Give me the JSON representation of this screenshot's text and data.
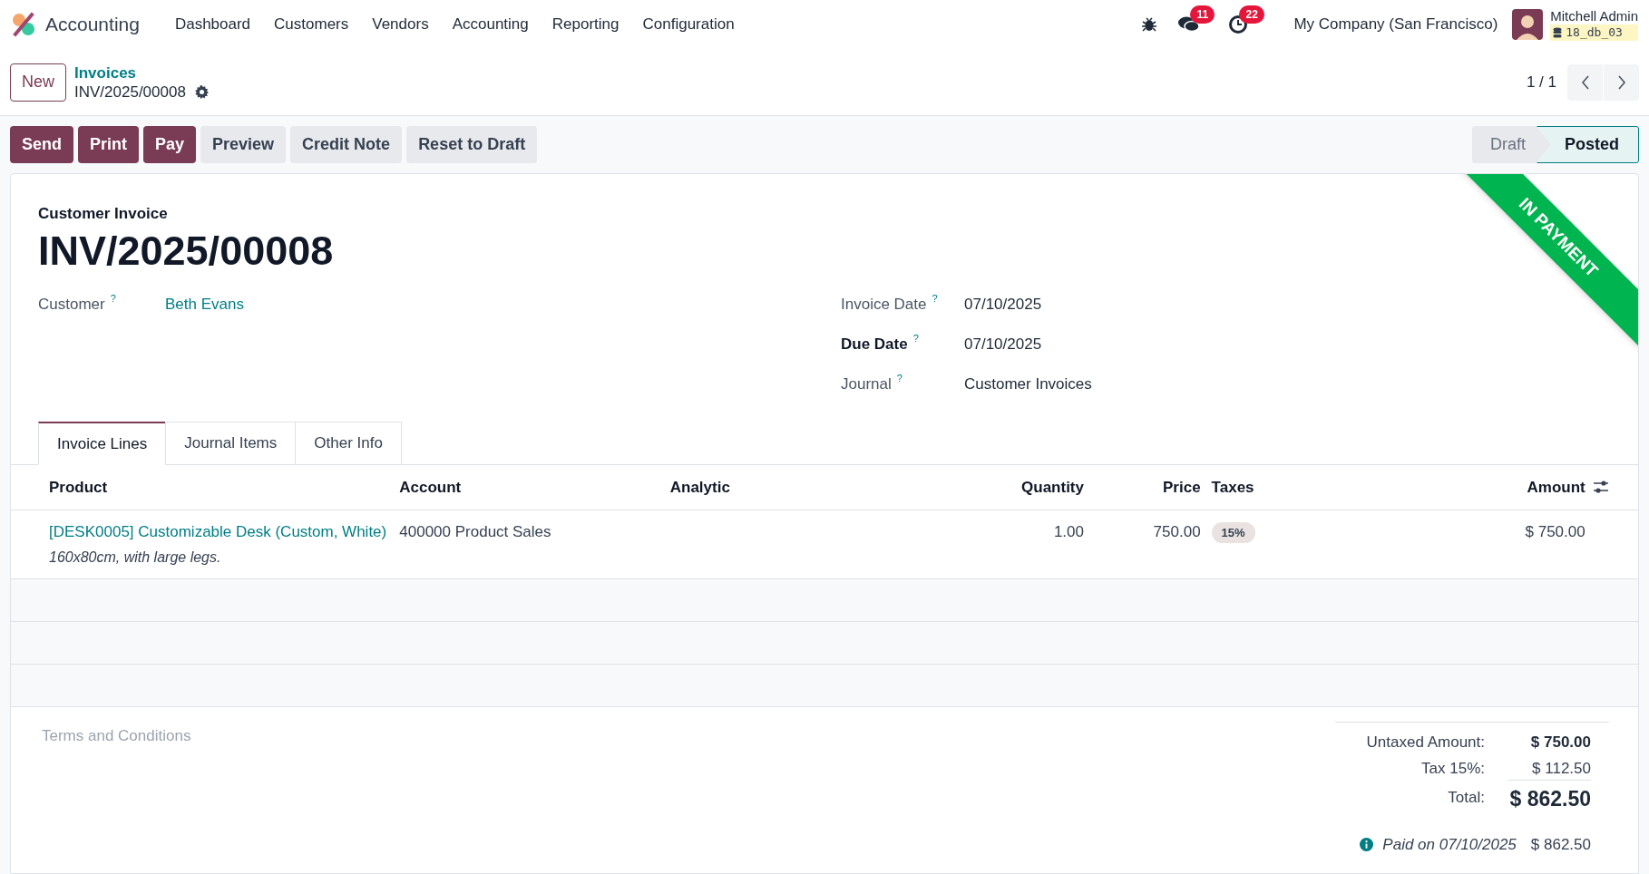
{
  "navbar": {
    "app": "Accounting",
    "menu": [
      "Dashboard",
      "Customers",
      "Vendors",
      "Accounting",
      "Reporting",
      "Configuration"
    ],
    "messages_count": "11",
    "activities_count": "22",
    "company": "My Company (San Francisco)",
    "user": "Mitchell Admin",
    "database": "18_db_03"
  },
  "control_panel": {
    "new_button": "New",
    "breadcrumb": "Invoices",
    "record": "INV/2025/00008",
    "pager": "1 / 1"
  },
  "actions": [
    {
      "label": "Send",
      "kind": "primary"
    },
    {
      "label": "Print",
      "kind": "primary"
    },
    {
      "label": "Pay",
      "kind": "primary"
    },
    {
      "label": "Preview",
      "kind": "secondary"
    },
    {
      "label": "Credit Note",
      "kind": "secondary"
    },
    {
      "label": "Reset to Draft",
      "kind": "secondary"
    }
  ],
  "stages": [
    {
      "label": "Draft",
      "selected": false
    },
    {
      "label": "Posted",
      "selected": true
    }
  ],
  "ribbon": "IN PAYMENT",
  "form": {
    "type_label": "Customer Invoice",
    "name": "INV/2025/00008",
    "left_fields": [
      {
        "label": "Customer",
        "help": "?",
        "value": "Beth Evans",
        "kind": "link",
        "required": false
      }
    ],
    "right_fields": [
      {
        "label": "Invoice Date",
        "help": "?",
        "value": "07/10/2025",
        "kind": "text",
        "required": false
      },
      {
        "label": "Due Date",
        "help": "?",
        "value": "07/10/2025",
        "kind": "text",
        "required": true
      },
      {
        "label": "Journal",
        "help": "?",
        "value": "Customer Invoices",
        "kind": "text",
        "required": false
      }
    ]
  },
  "tabs": [
    {
      "label": "Invoice Lines",
      "selected": true
    },
    {
      "label": "Journal Items",
      "selected": false
    },
    {
      "label": "Other Info",
      "selected": false
    }
  ],
  "table": {
    "columns": [
      {
        "label": "Product",
        "kind": "text"
      },
      {
        "label": "Account",
        "kind": "text"
      },
      {
        "label": "Analytic",
        "kind": "text"
      },
      {
        "label": "Quantity",
        "kind": "number"
      },
      {
        "label": "Price",
        "kind": "number"
      },
      {
        "label": "Taxes",
        "kind": "tag"
      },
      {
        "label": "Amount",
        "kind": "number"
      }
    ],
    "rows": [
      {
        "product": "[DESK0005] Customizable Desk (Custom, White)",
        "description": "160x80cm, with large legs.",
        "account": "400000 Product Sales",
        "analytic": "",
        "quantity": "1.00",
        "price": "750.00",
        "taxes": "15%",
        "amount": "$ 750.00"
      }
    ]
  },
  "terms_placeholder": "Terms and Conditions",
  "totals": [
    {
      "label": "Untaxed Amount:",
      "value": "$ 750.00",
      "kind": "subtotal"
    },
    {
      "label": "Tax 15%:",
      "value": "$ 112.50",
      "kind": "tax"
    },
    {
      "label": "Total:",
      "value": "$ 862.50",
      "kind": "total"
    }
  ],
  "payment": {
    "label": "Paid on 07/10/2025",
    "amount": "$ 862.50"
  }
}
